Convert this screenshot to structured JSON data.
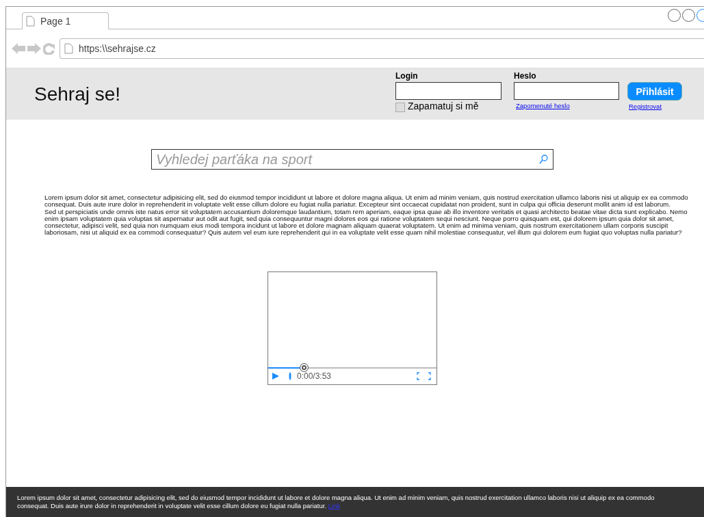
{
  "browser": {
    "tab": {
      "title": "Page 1"
    },
    "address": "https:\\\\sehrajse.cz"
  },
  "header": {
    "logo": "Sehraj se!",
    "login_label": "Login",
    "password_label": "Heslo",
    "submit": "Přihlásit",
    "remember": {
      "label": "Zapamatuj si mě",
      "checked": false
    },
    "forgot_link": "Zapomenuté heslo",
    "register_link": "Registrovat"
  },
  "search": {
    "placeholder": "Vyhledej parťáka na sport"
  },
  "paragraphs": [
    "Lorem ipsum dolor sit amet, consectetur adipisicing elit, sed do eiusmod tempor incididunt ut labore et dolore magna aliqua. Ut enim ad minim veniam, quis nostrud exercitation ullamco laboris nisi ut aliquip ex ea commodo consequat. Duis aute irure dolor in reprehenderit in voluptate velit esse cillum dolore eu fugiat nulla pariatur. Excepteur sint occaecat cupidatat non proident, sunt in culpa qui officia deserunt mollit anim id est laborum.",
    "Sed ut perspiciatis unde omnis iste natus error sit voluptatem accusantium doloremque laudantium, totam rem aperiam, eaque ipsa quae ab illo inventore veritatis et quasi architecto beatae vitae dicta sunt explicabo. Nemo enim ipsam voluptatem quia voluptas sit aspernatur aut odit aut fugit, sed quia consequuntur magni dolores eos qui ratione voluptatem sequi nesciunt. Neque porro quisquam est, qui dolorem ipsum quia dolor sit amet, consectetur, adipisci velit, sed quia non numquam eius modi tempora incidunt ut labore et dolore magnam aliquam quaerat voluptatem. Ut enim ad minima veniam, quis nostrum exercitationem ullam corporis suscipit laboriosam, nisi ut aliquid ex ea commodi consequatur? Quis autem vel eum iure reprehenderit qui in ea voluptate velit esse quam nihil molestiae consequatur, vel illum qui dolorem eum fugiat quo voluptas nulla pariatur?"
  ],
  "video": {
    "level": 0.215,
    "time": "0:00/3:53"
  },
  "footer": {
    "text": "Lorem ipsum dolor sit amet, consectetur adipisicing elit, sed do eiusmod tempor incididunt ut labore et dolore magna aliqua. Ut enim ad minim veniam, quis nostrud exercitation ullamco laboris nisi ut aliquip ex ea commodo consequat. Duis aute irure dolor in reprehenderit in voluptate velit esse cillum dolore eu fugiat nulla pariatur.",
    "link": "Link"
  }
}
